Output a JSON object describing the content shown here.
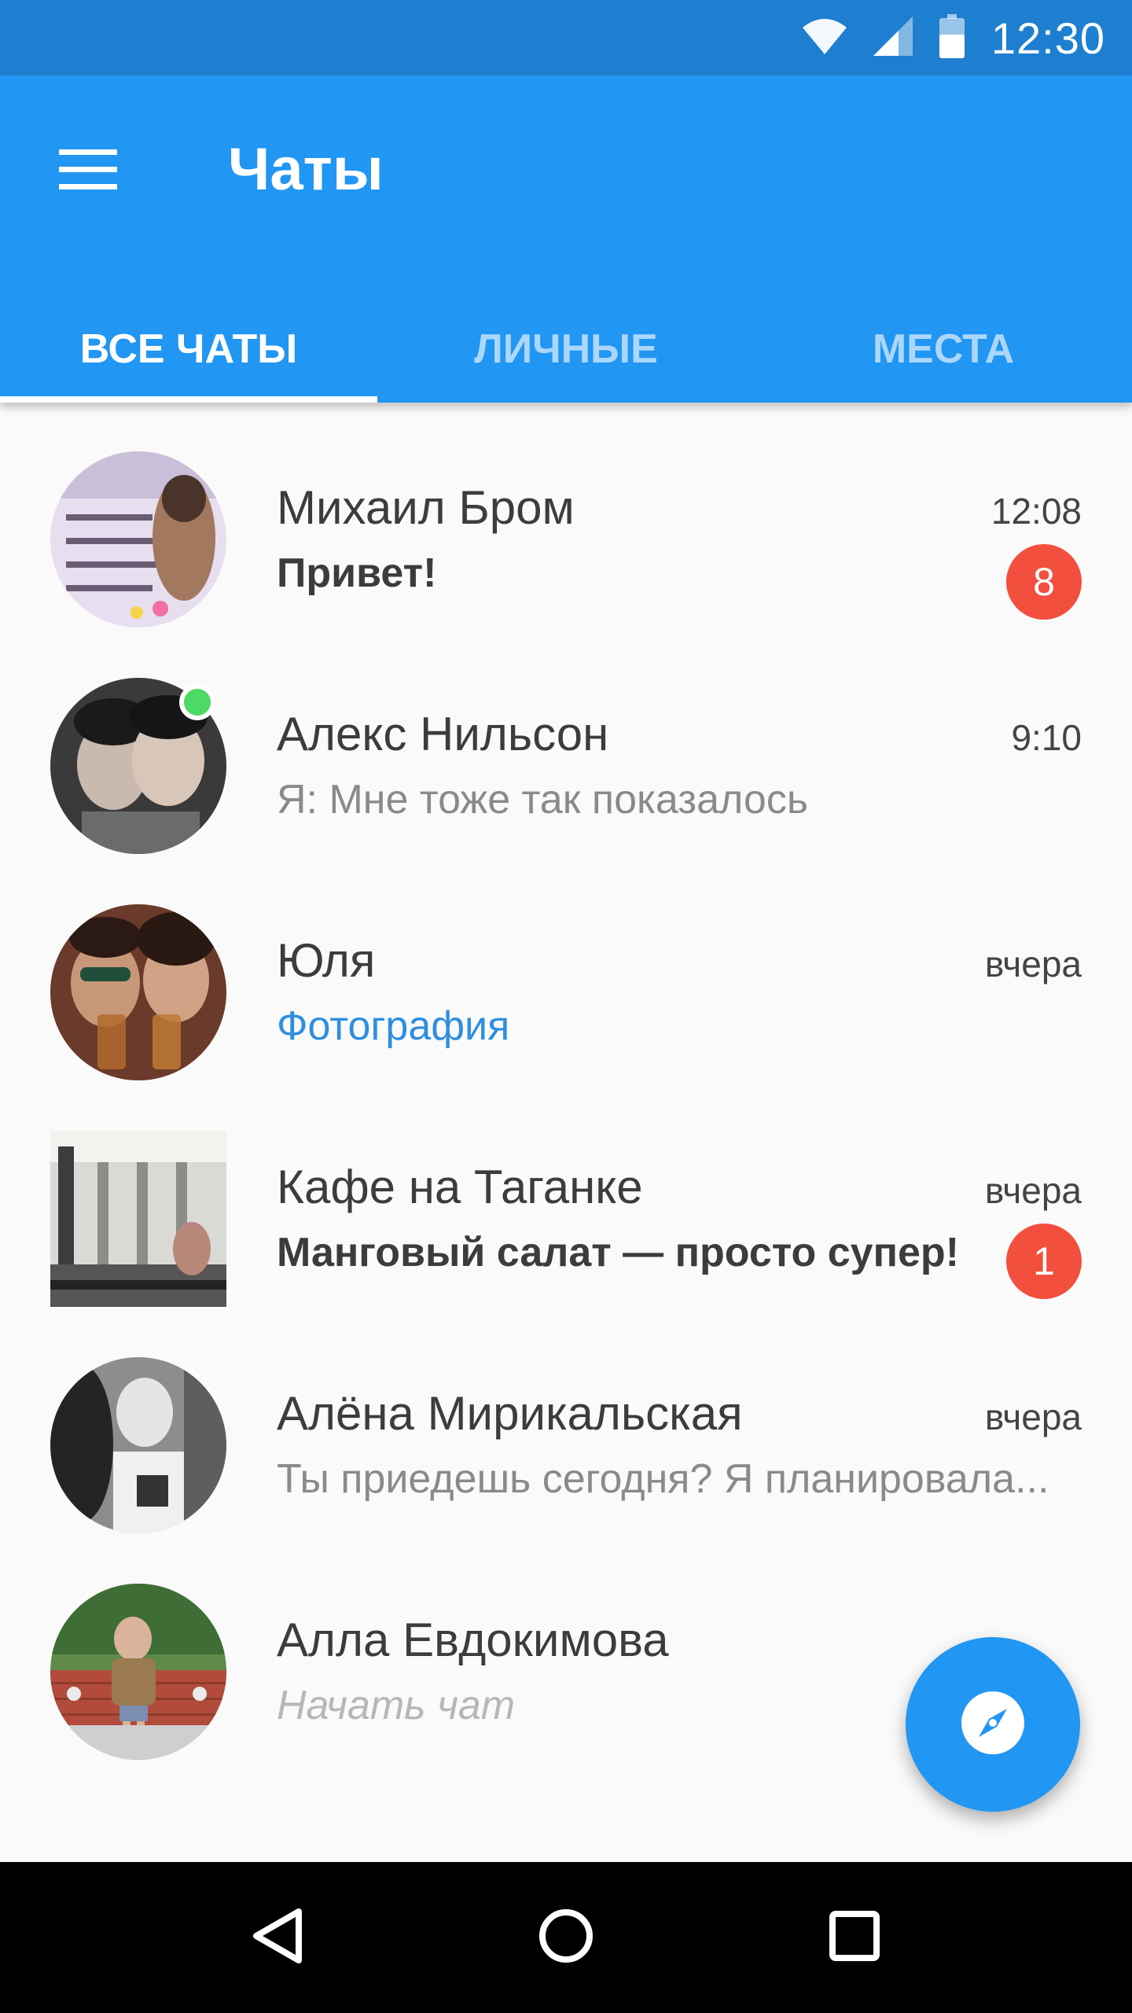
{
  "status_bar": {
    "time": "12:30",
    "icons": [
      "wifi-icon",
      "signal-icon",
      "battery-icon"
    ]
  },
  "app_bar": {
    "title": "Чаты",
    "menu_icon": "menu-icon",
    "background": "#2196f3"
  },
  "tabs": [
    {
      "label": "ВСЕ ЧАТЫ",
      "active": true
    },
    {
      "label": "ЛИЧНЫЕ",
      "active": false
    },
    {
      "label": "МЕСТА",
      "active": false
    }
  ],
  "chats": [
    {
      "name": "Михаил Бром",
      "time": "12:08",
      "preview": "Привет!",
      "unread": "8",
      "preview_style": "unread"
    },
    {
      "name": "Алекс Нильсон",
      "time": "9:10",
      "preview": "Я: Мне тоже так показалось",
      "online": true
    },
    {
      "name": "Юля",
      "time": "вчера",
      "preview": "Фотография",
      "preview_style": "media"
    },
    {
      "name": "Кафе на Таганке",
      "time": "вчера",
      "preview": "Манговый салат — просто супер!",
      "unread": "1",
      "preview_style": "unread"
    },
    {
      "name": "Алёна Мирикальская",
      "time": "вчера",
      "preview": "Ты приедешь сегодня? Я планировала..."
    },
    {
      "name": "Алла Евдокимова",
      "time": "",
      "preview": "Начать чат",
      "preview_style": "placeholder"
    }
  ],
  "fab": {
    "icon": "compass-icon"
  },
  "nav_bar": {
    "icons": [
      "back-icon",
      "home-icon",
      "recents-icon"
    ]
  },
  "colors": {
    "accent": "#2196f3",
    "status_bar": "#1e7fd0",
    "badge": "#f24f3e",
    "online": "#4cd964",
    "link": "#2f8ee0"
  }
}
